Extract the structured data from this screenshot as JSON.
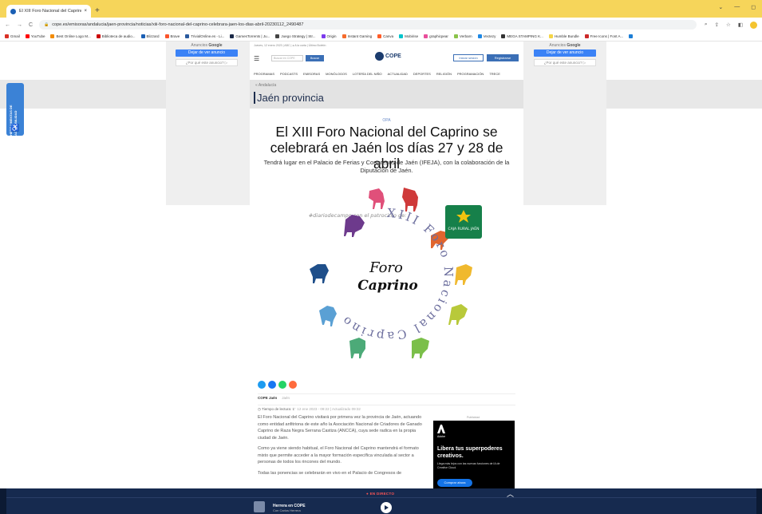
{
  "browser": {
    "tab_title": "El XIII Foro Nacional del Caprino",
    "tab_close": "×",
    "new_tab": "+",
    "url": "cope.es/emisoras/andalucia/jaen-provincia/noticias/xiii-foro-nacional-del-caprino-celebrara-jaen-los-dias-abril-20230112_2490487",
    "bookmarks": [
      "Gmail",
      "YouTube",
      "Best Online Logo M...",
      "Biblioteca de audio...",
      "Blizzard",
      "Brave",
      "TrivialOnline.es - Li...",
      "GamesTorrents | Ju...",
      "Juego Strategy | Str...",
      "Origin",
      "Instant Gaming",
      "Canva",
      "Mobirise",
      "graphicpear",
      "Verbarn",
      "Vectezy",
      "MEGA STAMPING K...",
      "Humble Bundle",
      "Free Icons | Font A..."
    ]
  },
  "ads": {
    "label_prefix": "Anuncios",
    "label_brand": "Google",
    "stop_button": "Dejar de ver anuncio",
    "why_link": "¿Por qué este anuncio? ▷"
  },
  "accessibility": {
    "label": "HERRAMIENTAS DE ACCESIBILIDAD"
  },
  "site": {
    "topline": "Jueves, 12 enero 2023  |  ABC  |  ● A la carta  |  Último Boletín",
    "search_placeholder": "Buscar en COPE",
    "search_button": "Buscar",
    "logo_text": "COPE",
    "login_button": "Iniciar sesión",
    "register_button": "Registrarse",
    "menu": [
      "PROGRAMAS",
      "PODCASTS",
      "EMISORAS",
      "MONÓLOGOS",
      "LOTERÍA DEL NIÑO",
      "ACTUALIDAD",
      "DEPORTES",
      "RELIGIÓN",
      "PROGRAMACIÓN",
      "TRECE"
    ]
  },
  "section": {
    "breadcrumb": "« Andalucía",
    "title": "Jaén provincia"
  },
  "article": {
    "kicker": "OPA",
    "headline": "El XIII Foro Nacional del Caprino se celebrará en Jaén los días 27 y 28 de abril",
    "subtitle": "Tendrá lugar en el Palacio de Ferias y Congresos de Jaén (IFEJA), con la colaboración de la Diputación de Jaén.",
    "image_text": {
      "hashtag": "#diariodecampo con el patrocinio de:",
      "ring": "XIII Foro Nacional Caprino",
      "center_1": "Foro",
      "center_2": "Caprino",
      "sponsor": "CAJA RURAL JAÉN"
    },
    "author": "COPE Jaén",
    "author_sub": "Jaén",
    "meta_reading": "Tiempo de lectura: 1'",
    "meta_date": "12 ene 2023 - 09:22 | Actualizado 09:32",
    "paragraphs": [
      "El Foro Nacional del Caprino visitará por primera vez la provincia de Jaén, actuando como entidad anfitriona de este año la Asociación Nacional de Criadores de Ganado Caprino de Raza Negra Serrana Castiza (ANCCA), cuya sede radica en la propia ciudad de Jaén.",
      "Como ya viene siendo habitual, el Foro Nacional del Caprino mantendrá el formato mixto que permite acceder a la mayor formación específica vinculada al sector a personas de todos los rincones del mundo.",
      "Todas las ponencias se celebrarán en vivo en el Palacio de Congresos de"
    ]
  },
  "promo": {
    "label": "Publicidad",
    "brand": "Adobe",
    "title": "Libera tus superpoderes creativos.",
    "text": "Llega más lejos con las nuevas funciones de IA de Creative Cloud.",
    "button": "Comprar ahora"
  },
  "live": {
    "tab_label": "EN DIRECTO",
    "show": "Herrera en COPE",
    "host": "Con Carlos Herrera"
  },
  "colors": {
    "tabbar": "#f6d55a",
    "brand_blue": "#1c3c6e",
    "ad_blue": "#3b82f6",
    "live_bg": "#162a4f"
  }
}
